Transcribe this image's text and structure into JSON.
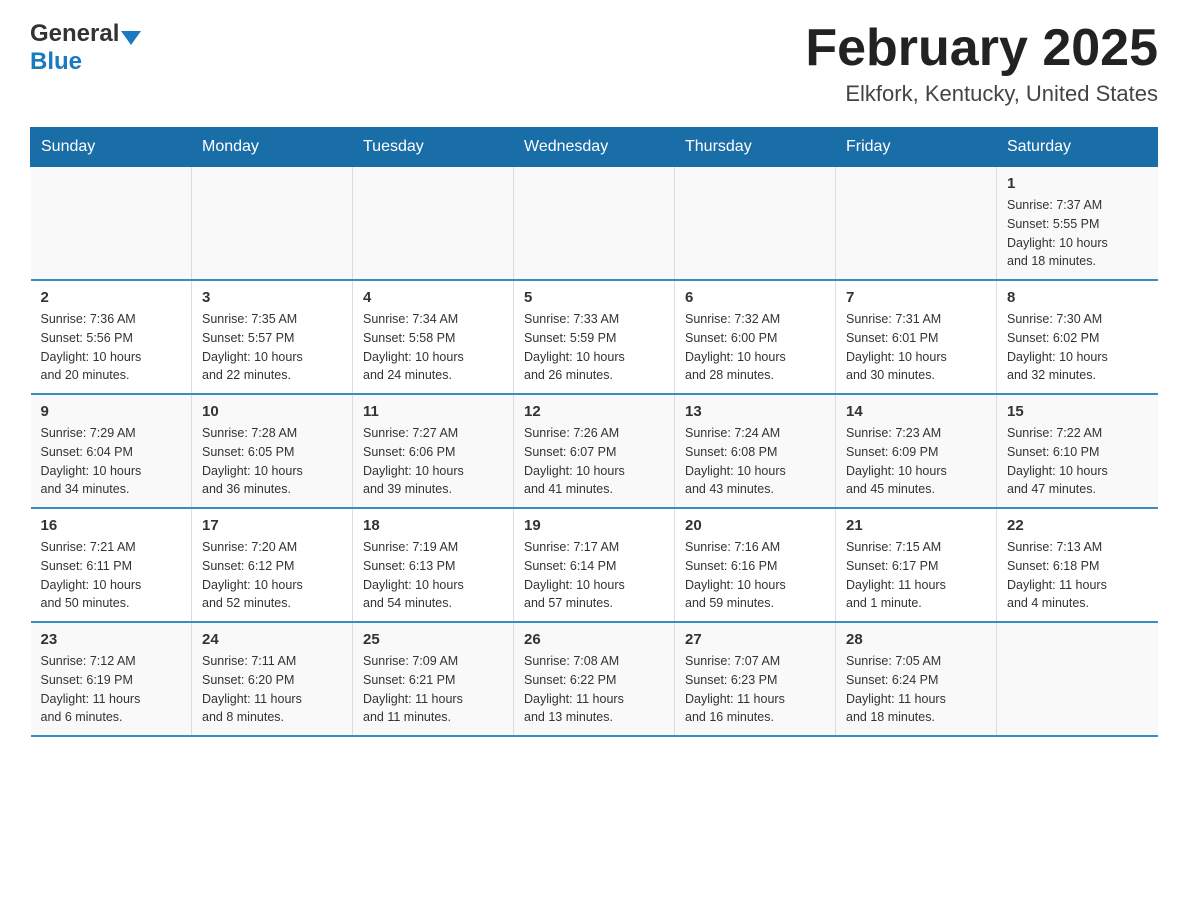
{
  "header": {
    "logo": {
      "general": "General",
      "blue": "Blue"
    },
    "title": "February 2025",
    "location": "Elkfork, Kentucky, United States"
  },
  "days_of_week": [
    "Sunday",
    "Monday",
    "Tuesday",
    "Wednesday",
    "Thursday",
    "Friday",
    "Saturday"
  ],
  "weeks": [
    [
      {
        "day": "",
        "info": ""
      },
      {
        "day": "",
        "info": ""
      },
      {
        "day": "",
        "info": ""
      },
      {
        "day": "",
        "info": ""
      },
      {
        "day": "",
        "info": ""
      },
      {
        "day": "",
        "info": ""
      },
      {
        "day": "1",
        "info": "Sunrise: 7:37 AM\nSunset: 5:55 PM\nDaylight: 10 hours\nand 18 minutes."
      }
    ],
    [
      {
        "day": "2",
        "info": "Sunrise: 7:36 AM\nSunset: 5:56 PM\nDaylight: 10 hours\nand 20 minutes."
      },
      {
        "day": "3",
        "info": "Sunrise: 7:35 AM\nSunset: 5:57 PM\nDaylight: 10 hours\nand 22 minutes."
      },
      {
        "day": "4",
        "info": "Sunrise: 7:34 AM\nSunset: 5:58 PM\nDaylight: 10 hours\nand 24 minutes."
      },
      {
        "day": "5",
        "info": "Sunrise: 7:33 AM\nSunset: 5:59 PM\nDaylight: 10 hours\nand 26 minutes."
      },
      {
        "day": "6",
        "info": "Sunrise: 7:32 AM\nSunset: 6:00 PM\nDaylight: 10 hours\nand 28 minutes."
      },
      {
        "day": "7",
        "info": "Sunrise: 7:31 AM\nSunset: 6:01 PM\nDaylight: 10 hours\nand 30 minutes."
      },
      {
        "day": "8",
        "info": "Sunrise: 7:30 AM\nSunset: 6:02 PM\nDaylight: 10 hours\nand 32 minutes."
      }
    ],
    [
      {
        "day": "9",
        "info": "Sunrise: 7:29 AM\nSunset: 6:04 PM\nDaylight: 10 hours\nand 34 minutes."
      },
      {
        "day": "10",
        "info": "Sunrise: 7:28 AM\nSunset: 6:05 PM\nDaylight: 10 hours\nand 36 minutes."
      },
      {
        "day": "11",
        "info": "Sunrise: 7:27 AM\nSunset: 6:06 PM\nDaylight: 10 hours\nand 39 minutes."
      },
      {
        "day": "12",
        "info": "Sunrise: 7:26 AM\nSunset: 6:07 PM\nDaylight: 10 hours\nand 41 minutes."
      },
      {
        "day": "13",
        "info": "Sunrise: 7:24 AM\nSunset: 6:08 PM\nDaylight: 10 hours\nand 43 minutes."
      },
      {
        "day": "14",
        "info": "Sunrise: 7:23 AM\nSunset: 6:09 PM\nDaylight: 10 hours\nand 45 minutes."
      },
      {
        "day": "15",
        "info": "Sunrise: 7:22 AM\nSunset: 6:10 PM\nDaylight: 10 hours\nand 47 minutes."
      }
    ],
    [
      {
        "day": "16",
        "info": "Sunrise: 7:21 AM\nSunset: 6:11 PM\nDaylight: 10 hours\nand 50 minutes."
      },
      {
        "day": "17",
        "info": "Sunrise: 7:20 AM\nSunset: 6:12 PM\nDaylight: 10 hours\nand 52 minutes."
      },
      {
        "day": "18",
        "info": "Sunrise: 7:19 AM\nSunset: 6:13 PM\nDaylight: 10 hours\nand 54 minutes."
      },
      {
        "day": "19",
        "info": "Sunrise: 7:17 AM\nSunset: 6:14 PM\nDaylight: 10 hours\nand 57 minutes."
      },
      {
        "day": "20",
        "info": "Sunrise: 7:16 AM\nSunset: 6:16 PM\nDaylight: 10 hours\nand 59 minutes."
      },
      {
        "day": "21",
        "info": "Sunrise: 7:15 AM\nSunset: 6:17 PM\nDaylight: 11 hours\nand 1 minute."
      },
      {
        "day": "22",
        "info": "Sunrise: 7:13 AM\nSunset: 6:18 PM\nDaylight: 11 hours\nand 4 minutes."
      }
    ],
    [
      {
        "day": "23",
        "info": "Sunrise: 7:12 AM\nSunset: 6:19 PM\nDaylight: 11 hours\nand 6 minutes."
      },
      {
        "day": "24",
        "info": "Sunrise: 7:11 AM\nSunset: 6:20 PM\nDaylight: 11 hours\nand 8 minutes."
      },
      {
        "day": "25",
        "info": "Sunrise: 7:09 AM\nSunset: 6:21 PM\nDaylight: 11 hours\nand 11 minutes."
      },
      {
        "day": "26",
        "info": "Sunrise: 7:08 AM\nSunset: 6:22 PM\nDaylight: 11 hours\nand 13 minutes."
      },
      {
        "day": "27",
        "info": "Sunrise: 7:07 AM\nSunset: 6:23 PM\nDaylight: 11 hours\nand 16 minutes."
      },
      {
        "day": "28",
        "info": "Sunrise: 7:05 AM\nSunset: 6:24 PM\nDaylight: 11 hours\nand 18 minutes."
      },
      {
        "day": "",
        "info": ""
      }
    ]
  ]
}
